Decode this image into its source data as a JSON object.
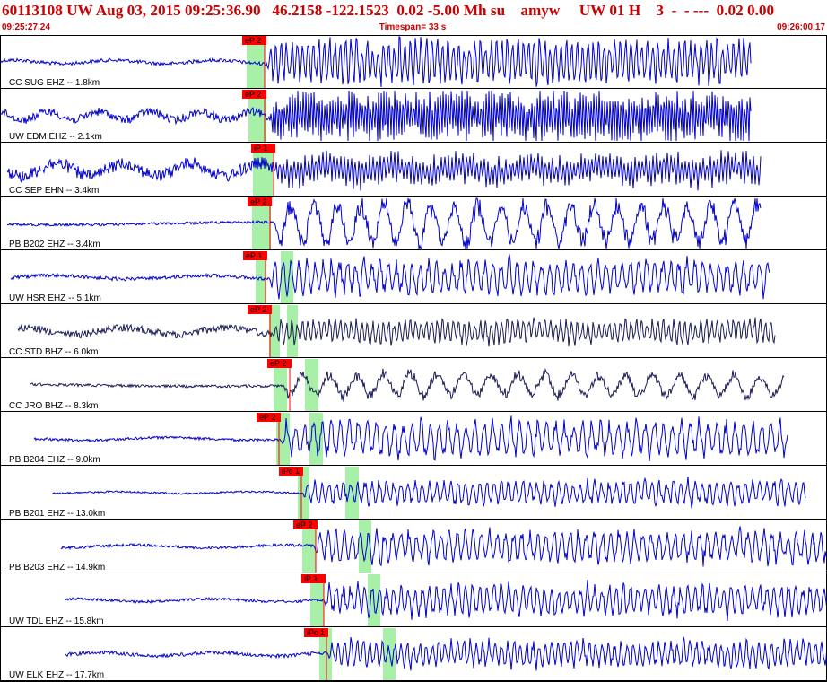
{
  "header": {
    "title": "60113108 UW Aug 03, 2015 09:25:36.90   46.2158 -122.1523  0.02 -5.00 Mh su    amyw     UW 01 H    3  -  - ---  0.02 0.00",
    "start_time": "09:25:27.24",
    "timespan": "Timespan=  33 s",
    "end_time": "09:26:00.17"
  },
  "colors": {
    "header_text": "#cc0000",
    "trace_blue": "#0000cc",
    "trace_dark": "#1a1a55",
    "pick_flag": "#ff0000",
    "pick_window": "#a8f0a8",
    "border": "#000000"
  },
  "traces": [
    {
      "label": "CC SUG EHZ -- 1.8km",
      "color": "blue",
      "pick": "eP 2",
      "noise": 4,
      "amp": 25,
      "period": 6,
      "start": 0,
      "end": 837,
      "onset": 297,
      "pick_t": 270,
      "windows": [
        [
          275,
          295
        ]
      ]
    },
    {
      "label": "UW EDM EHZ -- 2.1km",
      "color": "blue",
      "pick": "eP 2",
      "noise": 9,
      "amp": 28,
      "period": 3,
      "start": 0,
      "end": 837,
      "onset": 300,
      "pick_t": 270,
      "windows": [
        [
          277,
          297
        ]
      ]
    },
    {
      "label": "CC SEP EHN -- 3.4km",
      "color": "blue",
      "pick": "iP 1",
      "noise": 14,
      "amp": 16,
      "period": 4,
      "start": 8,
      "end": 848,
      "onset": 305,
      "pick_t": 280,
      "windows": [
        [
          282,
          304
        ]
      ]
    },
    {
      "label": "PB B202 EHZ -- 3.4km",
      "color": "blue",
      "pick": "eP 2",
      "noise": 3,
      "amp": 27,
      "period": 26,
      "start": 8,
      "end": 848,
      "onset": 305,
      "pick_t": 276,
      "windows": [
        [
          281,
          302
        ]
      ]
    },
    {
      "label": "UW HSR EHZ -- 5.1km",
      "color": "blue",
      "pick": "eP 1",
      "noise": 4,
      "amp": 20,
      "period": 9,
      "start": 12,
      "end": 858,
      "onset": 300,
      "pick_t": 271,
      "windows": [
        [
          285,
          297
        ],
        [
          313,
          327
        ]
      ]
    },
    {
      "label": "CC STD BHZ -- 6.0km",
      "color": "dark",
      "pick": "eP 2",
      "noise": 8,
      "amp": 14,
      "period": 6,
      "start": 20,
      "end": 864,
      "onset": 303,
      "pick_t": 276,
      "windows": [
        [
          300,
          312
        ],
        [
          320,
          332
        ]
      ]
    },
    {
      "label": "CC JRO BHZ -- 8.3km",
      "color": "dark",
      "pick": "eP 2",
      "noise": 3,
      "amp": 15,
      "period": 30,
      "start": 34,
      "end": 874,
      "onset": 315,
      "pick_t": 298,
      "windows": [
        [
          305,
          320
        ],
        [
          340,
          355
        ]
      ]
    },
    {
      "label": "PB B204 EHZ -- 9.0km",
      "color": "blue",
      "pick": "eP 2",
      "noise": 3,
      "amp": 21,
      "period": 10,
      "start": 38,
      "end": 878,
      "onset": 312,
      "pick_t": 286,
      "windows": [
        [
          308,
          323
        ],
        [
          345,
          360
        ]
      ]
    },
    {
      "label": "PB B201 EHZ -- 13.0km",
      "color": "blue",
      "pick": "iPc 1",
      "noise": 2,
      "amp": 14,
      "period": 8,
      "start": 58,
      "end": 898,
      "onset": 337,
      "pick_t": 311,
      "windows": [
        [
          332,
          345
        ],
        [
          385,
          400
        ]
      ]
    },
    {
      "label": "PB B203 EHZ -- 14.9km",
      "color": "blue",
      "pick": "eP 2",
      "noise": 3,
      "amp": 18,
      "period": 9,
      "start": 68,
      "end": 922,
      "onset": 350,
      "pick_t": 327,
      "windows": [
        [
          337,
          352
        ],
        [
          400,
          414
        ]
      ]
    },
    {
      "label": "UW TDL EHZ -- 15.8km",
      "color": "blue",
      "pick": "iP 1",
      "noise": 3,
      "amp": 18,
      "period": 8,
      "start": 72,
      "end": 922,
      "onset": 361,
      "pick_t": 336,
      "windows": [
        [
          346,
          361
        ],
        [
          410,
          424
        ]
      ]
    },
    {
      "label": "UW ELK EHZ -- 17.7km",
      "color": "blue",
      "pick": "iPc 1",
      "noise": 4,
      "amp": 15,
      "period": 7,
      "start": 72,
      "end": 922,
      "onset": 365,
      "pick_t": 339,
      "windows": [
        [
          356,
          370
        ],
        [
          427,
          441
        ]
      ]
    }
  ]
}
